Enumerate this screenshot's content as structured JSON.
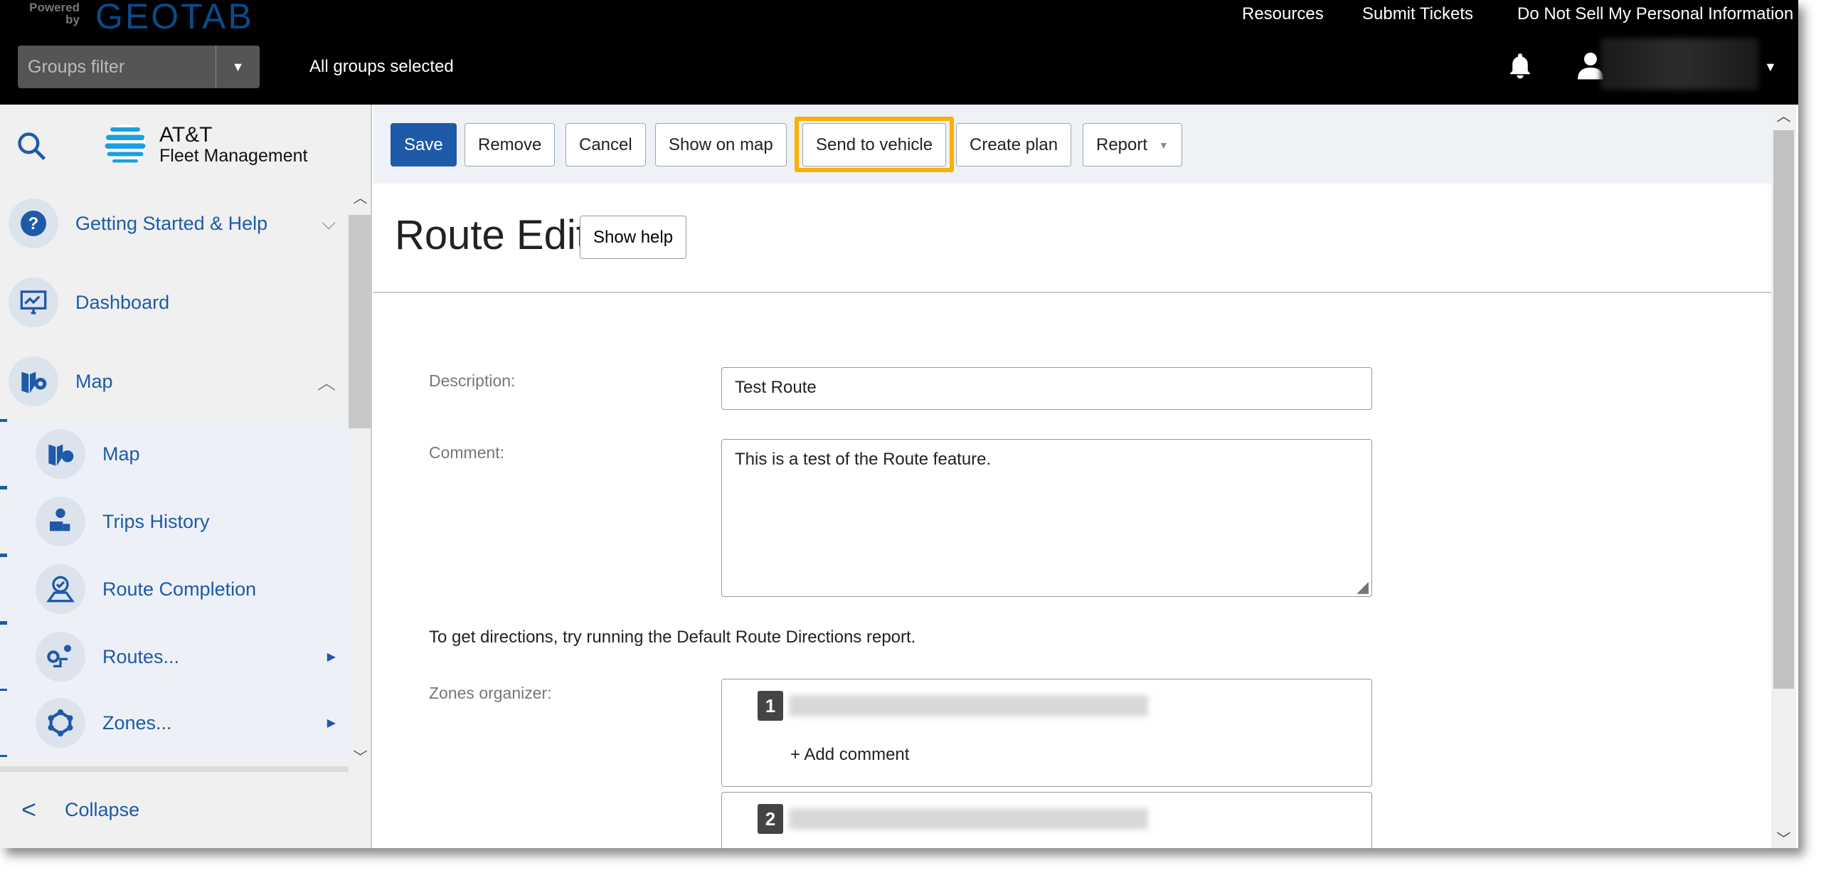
{
  "header": {
    "powered_by": "Powered by",
    "brand": "GEOTAB",
    "groups_filter_placeholder": "Groups filter",
    "groups_status": "All groups selected",
    "links": [
      "Resources",
      "Submit Tickets",
      "Do Not Sell My Personal Information"
    ]
  },
  "sidebar": {
    "logo_line1": "AT&T",
    "logo_line2": "Fleet Management",
    "items": [
      {
        "label": "Getting Started & Help",
        "icon": "help-icon"
      },
      {
        "label": "Dashboard",
        "icon": "dashboard-icon"
      },
      {
        "label": "Map",
        "icon": "map-icon"
      }
    ],
    "subitems": [
      {
        "label": "Map",
        "icon": "map-icon"
      },
      {
        "label": "Trips History",
        "icon": "trips-history-icon"
      },
      {
        "label": "Route Completion",
        "icon": "route-completion-icon"
      },
      {
        "label": "Routes...",
        "icon": "routes-icon"
      },
      {
        "label": "Zones...",
        "icon": "zones-icon"
      }
    ],
    "collapse": "Collapse"
  },
  "toolbar": {
    "save": "Save",
    "remove": "Remove",
    "cancel": "Cancel",
    "show_on_map": "Show on map",
    "send_to_vehicle": "Send to vehicle",
    "create_plan": "Create plan",
    "report": "Report"
  },
  "page": {
    "title": "Route Edit",
    "show_help": "Show help",
    "description_label": "Description:",
    "description_value": "Test Route",
    "comment_label": "Comment:",
    "comment_value": "This is a test of the Route feature.",
    "directions_note": "To get directions, try running the Default Route Directions report.",
    "zones_label": "Zones organizer:",
    "zones": [
      {
        "number": "1",
        "add_comment": "+ Add comment"
      },
      {
        "number": "2"
      }
    ]
  },
  "colors": {
    "accent": "#1e5aa8",
    "highlight": "#f9b000"
  }
}
